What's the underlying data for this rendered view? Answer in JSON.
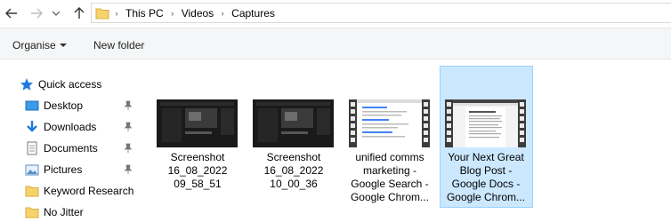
{
  "breadcrumb": [
    "This PC",
    "Videos",
    "Captures"
  ],
  "toolbar": {
    "organise_label": "Organise",
    "new_folder_label": "New folder"
  },
  "nav": {
    "quick_access": "Quick access",
    "items": [
      {
        "label": "Desktop",
        "icon": "desktop-icon",
        "pinned": true
      },
      {
        "label": "Downloads",
        "icon": "downloads-icon",
        "pinned": true
      },
      {
        "label": "Documents",
        "icon": "documents-icon",
        "pinned": true
      },
      {
        "label": "Pictures",
        "icon": "pictures-icon",
        "pinned": true
      },
      {
        "label": "Keyword Research",
        "icon": "folder-icon",
        "pinned": false
      },
      {
        "label": "No Jitter",
        "icon": "folder-icon",
        "pinned": false
      }
    ]
  },
  "files": [
    {
      "label": "Screenshot\n16_08_2022\n09_58_51",
      "thumb": "screenshot-dark",
      "selected": false
    },
    {
      "label": "Screenshot\n16_08_2022\n10_00_36",
      "thumb": "screenshot-dark",
      "selected": false
    },
    {
      "label": "unified comms\nmarketing -\nGoogle Search -\nGoogle Chrom...",
      "thumb": "video-search",
      "selected": false
    },
    {
      "label": "Your Next Great\nBlog Post -\nGoogle Docs -\nGoogle Chrom...",
      "thumb": "video-docs",
      "selected": true
    }
  ],
  "colors": {
    "selection_bg": "#cce8ff",
    "selection_border": "#99d1ff",
    "folder": "#f7d36b",
    "accent": "#1e7bd8"
  }
}
